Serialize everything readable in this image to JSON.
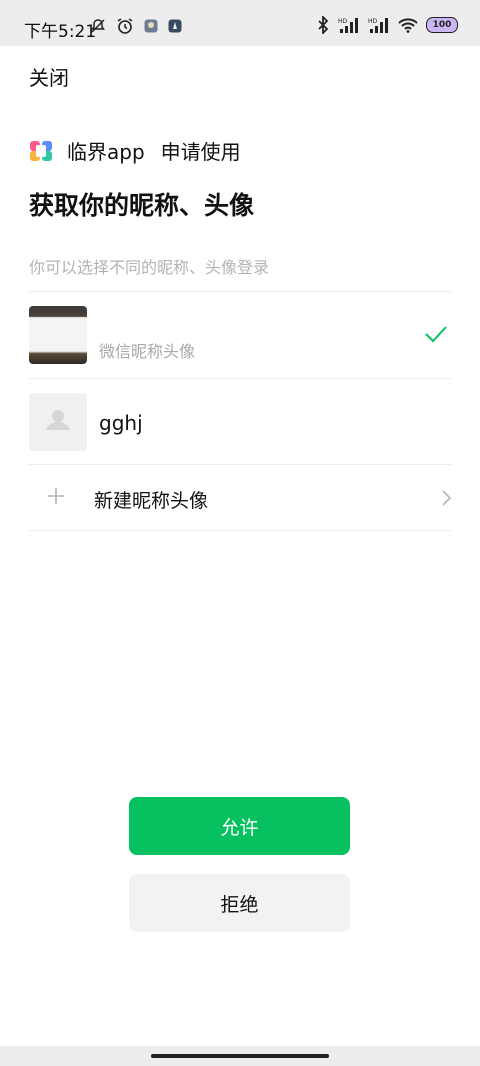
{
  "status_bar": {
    "time": "下午5:21",
    "battery": "100",
    "icons": [
      "mute-icon",
      "alarm-icon",
      "app-notification-icon",
      "app-notification-icon",
      "bluetooth-icon",
      "hd-signal-icon",
      "hd-signal-icon",
      "wifi-icon",
      "battery-icon"
    ]
  },
  "header": {
    "close_label": "关闭"
  },
  "app": {
    "name": "临界app",
    "request_text": "申请使用"
  },
  "title": "获取你的昵称、头像",
  "subtitle": "你可以选择不同的昵称、头像登录",
  "options": [
    {
      "label": "微信昵称头像",
      "selected": true
    },
    {
      "label": "gghj",
      "selected": false
    },
    {
      "label": "新建昵称头像"
    }
  ],
  "buttons": {
    "allow": "允许",
    "deny": "拒绝"
  },
  "colors": {
    "accent": "#07c160",
    "check": "#07c160"
  }
}
